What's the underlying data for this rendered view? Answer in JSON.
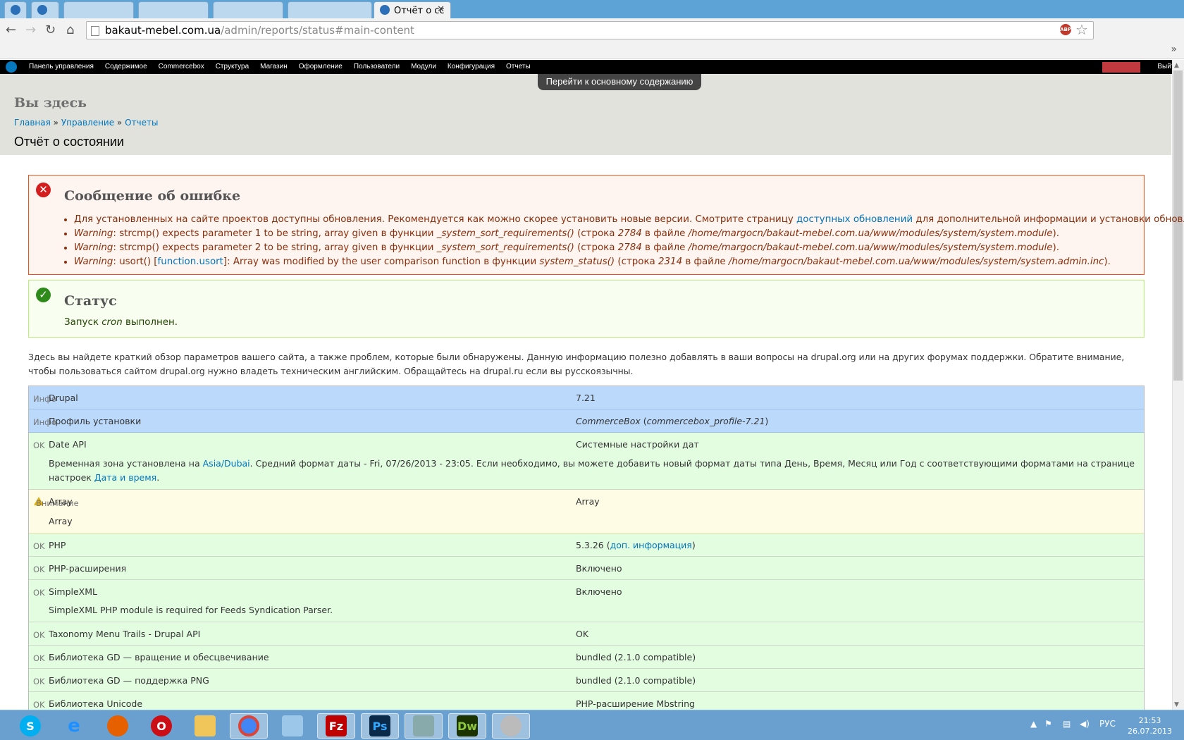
{
  "browser": {
    "active_tab_title": "Отчёт о сс",
    "url_host": "bakaut-mebel.com.ua",
    "url_path": "/admin/reports/status#main-content",
    "colors": {
      "tabstrip": "#5ea3d6",
      "toolbar": "#f2f2f2"
    }
  },
  "admin_menu": {
    "items": [
      "Панель управления",
      "Содержимое",
      "Commercebox",
      "Структура",
      "Магазин",
      "Оформление",
      "Пользователи",
      "Модули",
      "Конфигурация",
      "Отчеты"
    ],
    "logout": "Выйти"
  },
  "skip_link": "Перейти к основному содержанию",
  "header": {
    "here": "Вы здесь",
    "breadcrumb": [
      "Главная",
      "Управление",
      "Отчеты"
    ],
    "breadcrumb_sep": " » ",
    "title": "Отчёт о состоянии"
  },
  "error_message": {
    "heading": "Сообщение об ошибке",
    "item1_prefix": "Для установленных на сайте проектов доступны обновления. Рекомендуется как можно скорее установить новые версии. Смотрите страницу ",
    "item1_link": "доступных обновлений",
    "item1_suffix": " для дополнительной информации и установки обновлений.",
    "warning_label": "Warning",
    "item2_a": ": strcmp() expects parameter 1 to be string, array given в функции ",
    "item2_func": "_system_sort_requirements()",
    "item2_b": " (строка ",
    "item2_line": "2784",
    "item2_c": " в файле ",
    "item2_file": "/home/margocn/bakaut-mebel.com.ua/www/modules/system/system.module",
    "item2_d": ").",
    "item3_a": ": strcmp() expects parameter 2 to be string, array given в функции ",
    "item3_func": "_system_sort_requirements()",
    "item3_b": " (строка ",
    "item3_line": "2784",
    "item3_c": " в файле ",
    "item3_file": "/home/margocn/bakaut-mebel.com.ua/www/modules/system/system.module",
    "item3_d": ").",
    "item4_a": ": usort() [",
    "item4_link": "function.usort",
    "item4_b": "]: Array was modified by the user comparison function в функции ",
    "item4_func": "system_status()",
    "item4_c": " (строка ",
    "item4_line": "2314",
    "item4_d": " в файле ",
    "item4_file": "/home/margocn/bakaut-mebel.com.ua/www/modules/system/system.admin.inc",
    "item4_e": ")."
  },
  "status_message": {
    "heading": "Статус",
    "text_a": "Запуск ",
    "text_em": "cron",
    "text_b": " выполнен."
  },
  "intro": "Здесь вы найдете краткий обзор параметров вашего сайта, а также проблем, которые были обнаружены. Данную информацию полезно добавлять в ваши вопросы на drupal.org или на других форумах поддержки. Обратите внимание, чтобы пользоваться сайтом drupal.org нужно владеть техническим английским. Обращайтесь на drupal.ru если вы русскоязычны.",
  "table": {
    "sev_info": "Инфо",
    "sev_ok": "OK",
    "sev_warning": "Внимание",
    "r1": {
      "title": "Drupal",
      "value": "7.21"
    },
    "r2": {
      "title": "Профиль установки",
      "value_em": "CommerceBox",
      "value_b": " (",
      "value_em2": "commercebox_profile-7.21",
      "value_c": ")"
    },
    "r3": {
      "title": "Date API",
      "value": "Системные настройки дат",
      "desc_a": "Временная зона установлена на ",
      "desc_link": "Asia/Dubai",
      "desc_b": ". Средний формат даты - Fri, 07/26/2013 - 23:05. Если необходимо, вы можете добавить новый формат даты типа День, Время, Месяц или Год с соответствующими форматами на странице настроек ",
      "desc_link2": "Дата и время",
      "desc_c": "."
    },
    "r4": {
      "title": "Array",
      "value": "Array",
      "desc": "Array"
    },
    "r5": {
      "title": "PHP",
      "value_a": "5.3.26 (",
      "value_link": "доп. информация",
      "value_b": ")"
    },
    "r6": {
      "title": "PHP-расширения",
      "value": "Включено"
    },
    "r7": {
      "title": "SimpleXML",
      "value": "Включено",
      "desc": "SimpleXML PHP module is required for Feeds Syndication Parser."
    },
    "r8": {
      "title": "Taxonomy Menu Trails - Drupal API",
      "value": "OK"
    },
    "r9": {
      "title": "Библиотека GD — вращение и обесцвечивание",
      "value": "bundled (2.1.0 compatible)"
    },
    "r10": {
      "title": "Библиотека GD — поддержка PNG",
      "value": "bundled (2.1.0 compatible)"
    },
    "r11": {
      "title": "Библиотека Unicode",
      "value": "PHP-расширение Mbstring"
    }
  },
  "taskbar": {
    "apps": [
      "skype",
      "internet-explorer",
      "firefox",
      "opera",
      "file-explorer",
      "chrome",
      "notepad",
      "filezilla",
      "photoshop",
      "archive",
      "dreamweaver",
      "media-player"
    ],
    "ps_label": "Ps",
    "dw_label": "Dw",
    "lang": "РУС",
    "time": "21:53",
    "date": "26.07.2013"
  }
}
